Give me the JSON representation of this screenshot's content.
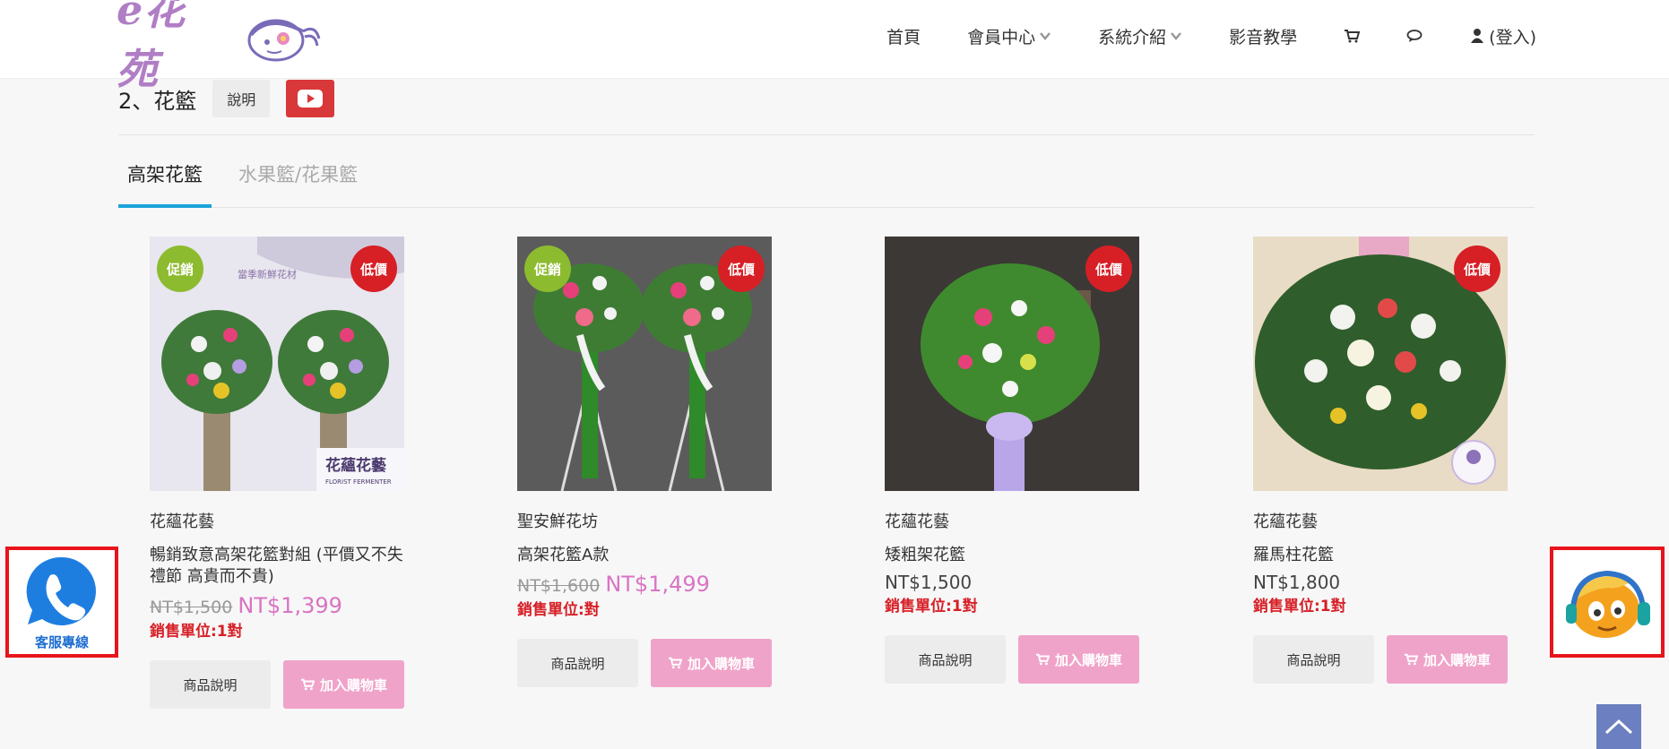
{
  "header": {
    "logo_text": "e花苑",
    "nav": [
      {
        "label": "首頁"
      },
      {
        "label": "會員中心"
      },
      {
        "label": "系統介紹"
      },
      {
        "label": "影音教學"
      }
    ],
    "login_label": "(登入)"
  },
  "section": {
    "title": "2、花籃",
    "desc_button": "說明"
  },
  "tabs": [
    {
      "label": "高架花籃",
      "active": true
    },
    {
      "label": "水果籃/花果籃",
      "active": false
    }
  ],
  "products": [
    {
      "shop": "花蘊花藝",
      "name": "暢銷致意高架花籃對組 (平價又不失禮節 高貴而不貴)",
      "old_price": "NT$1,500",
      "price": "NT$1,399",
      "unit": "銷售單位:1對",
      "badges": [
        "促銷",
        "低價"
      ],
      "image_caption": "花蘊花藝",
      "image_caption_sub": "FLORIST FERMENTER",
      "image_banner": "當季新鮮花材"
    },
    {
      "shop": "聖安鮮花坊",
      "name": "高架花籃A款",
      "old_price": "NT$1,600",
      "price": "NT$1,499",
      "unit": "銷售單位:對",
      "badges": [
        "促銷",
        "低價"
      ]
    },
    {
      "shop": "花蘊花藝",
      "name": "矮粗架花籃",
      "old_price": "",
      "price": "NT$1,500",
      "unit": "銷售單位:1對",
      "badges": [
        "低價"
      ]
    },
    {
      "shop": "花蘊花藝",
      "name": "羅馬柱花籃",
      "old_price": "",
      "price": "NT$1,800",
      "unit": "銷售單位:1對",
      "badges": [
        "低價"
      ]
    }
  ],
  "buttons": {
    "desc": "商品說明",
    "cart": "加入購物車"
  },
  "widgets": {
    "service_label": "客服專線"
  },
  "colors": {
    "accent_tab": "#1aa3d9",
    "price_pink": "#d974c4",
    "cart_button": "#f0a3c9",
    "promo_badge": "#8dbb2f",
    "low_badge": "#d71f26",
    "highlight_border": "#e8141c"
  },
  "icons": [
    "cart-icon",
    "chat-icon",
    "user-icon",
    "youtube-icon",
    "phone-icon",
    "chevron-down-icon",
    "arrow-up-icon"
  ]
}
